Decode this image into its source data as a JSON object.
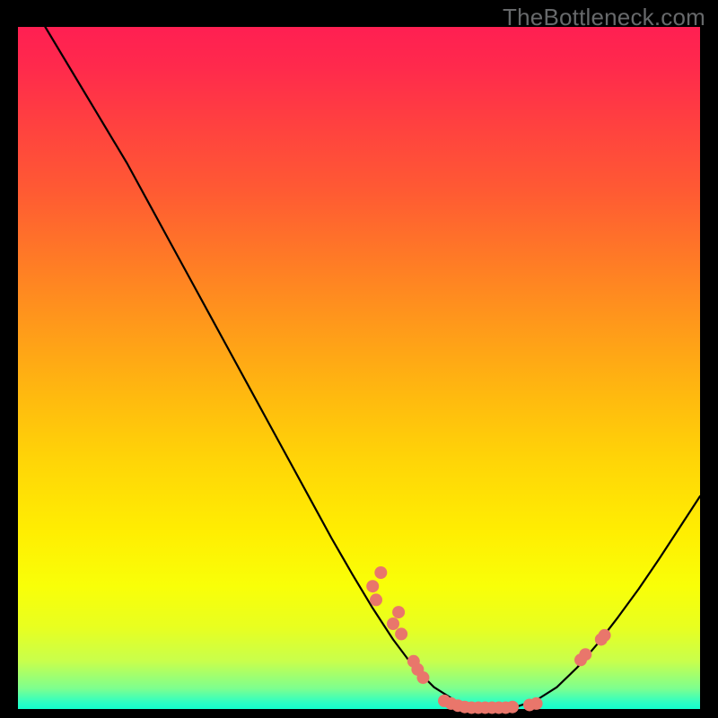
{
  "watermark": "TheBottleneck.com",
  "colors": {
    "marker_fill": "#e9766b",
    "marker_stroke": "#d65f55",
    "curve": "#000000"
  },
  "chart_data": {
    "type": "line",
    "title": "",
    "xlabel": "",
    "ylabel": "",
    "xlim": [
      0,
      100
    ],
    "ylim": [
      0,
      100
    ],
    "curve_points_xy": [
      [
        4,
        100
      ],
      [
        7,
        95
      ],
      [
        10,
        90
      ],
      [
        13,
        85
      ],
      [
        16,
        80
      ],
      [
        19,
        74.5
      ],
      [
        22,
        69
      ],
      [
        25,
        63.5
      ],
      [
        28,
        58
      ],
      [
        31,
        52.5
      ],
      [
        34,
        47
      ],
      [
        37,
        41.5
      ],
      [
        40,
        36
      ],
      [
        43,
        30.5
      ],
      [
        46,
        25
      ],
      [
        49,
        19.8
      ],
      [
        52,
        14.8
      ],
      [
        55,
        10.2
      ],
      [
        58,
        6.2
      ],
      [
        61,
        3.2
      ],
      [
        64,
        1.3
      ],
      [
        67,
        0.3
      ],
      [
        70,
        0
      ],
      [
        73,
        0.3
      ],
      [
        76,
        1.3
      ],
      [
        79,
        3.2
      ],
      [
        82,
        6.1
      ],
      [
        85,
        9.6
      ],
      [
        88,
        13.5
      ],
      [
        91,
        17.6
      ],
      [
        94,
        22.0
      ],
      [
        97,
        26.6
      ],
      [
        100,
        31.2
      ]
    ],
    "markers_xy": [
      [
        52.0,
        18.0
      ],
      [
        52.5,
        16.0
      ],
      [
        53.2,
        20.0
      ],
      [
        55.0,
        12.5
      ],
      [
        55.8,
        14.2
      ],
      [
        56.2,
        11.0
      ],
      [
        58.0,
        7.0
      ],
      [
        58.6,
        5.8
      ],
      [
        59.4,
        4.6
      ],
      [
        62.5,
        1.2
      ],
      [
        63.5,
        0.8
      ],
      [
        64.5,
        0.5
      ],
      [
        65.5,
        0.3
      ],
      [
        66.5,
        0.2
      ],
      [
        67.5,
        0.2
      ],
      [
        68.5,
        0.2
      ],
      [
        69.5,
        0.2
      ],
      [
        70.5,
        0.2
      ],
      [
        71.5,
        0.2
      ],
      [
        72.5,
        0.3
      ],
      [
        75.0,
        0.6
      ],
      [
        76.0,
        0.8
      ],
      [
        82.5,
        7.2
      ],
      [
        83.2,
        8.0
      ],
      [
        85.5,
        10.2
      ],
      [
        86.0,
        10.8
      ]
    ]
  }
}
